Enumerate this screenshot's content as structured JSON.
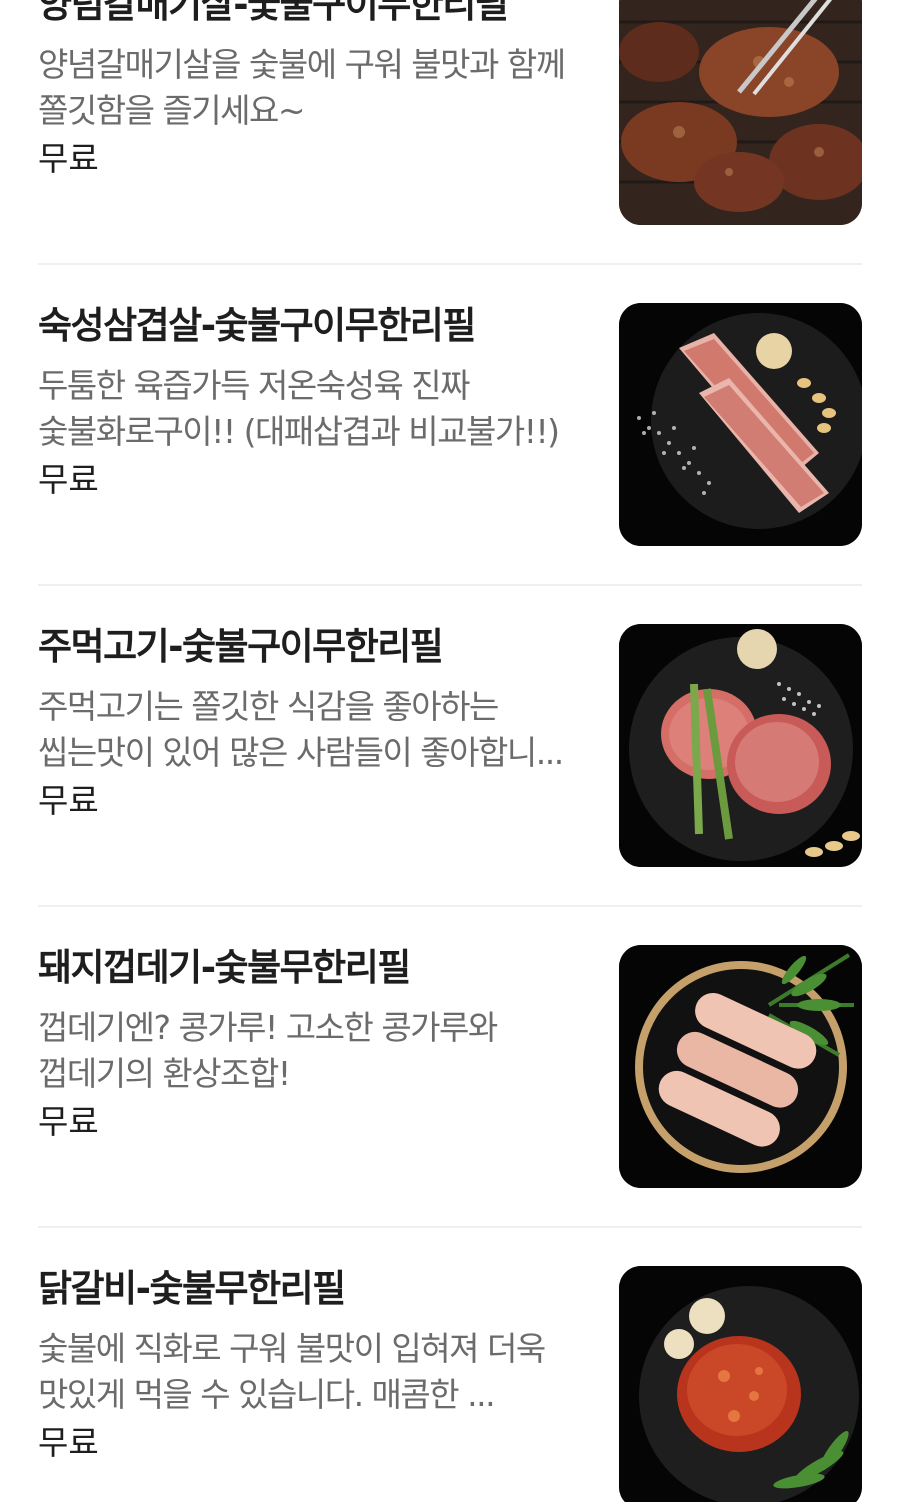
{
  "menu": {
    "items": [
      {
        "name": "양념갈매기살-숯불구이무한리필",
        "description": "양념갈매기살을 숯불에 구워 불맛과 함께 쫄깃함을 즐기세요~",
        "price": "무료",
        "image_icon": "marinated-pork-skirt-photo"
      },
      {
        "name": "숙성삼겹살-숯불구이무한리필",
        "description": "두툼한 육즙가득 저온숙성육 진짜 숯불화로구이!! (대패삽겹과 비교불가!!)",
        "price": "무료",
        "image_icon": "pork-belly-photo"
      },
      {
        "name": "주먹고기-숯불구이무한리필",
        "description": "주먹고기는 쫄깃한 식감을 좋아하는 씹는맛이 있어 많은 사람들이 좋아합니...",
        "price": "무료",
        "image_icon": "pork-neck-photo"
      },
      {
        "name": "돼지껍데기-숯불무한리필",
        "description": "껍데기엔? 콩가루! 고소한 콩가루와 껍데기의 환상조합!",
        "price": "무료",
        "image_icon": "pork-skin-photo"
      },
      {
        "name": "닭갈비-숯불무한리필",
        "description": "숯불에 직화로 구워 불맛이 입혀져 더욱 맛있게 먹을 수 있습니다. 매콤한 ...",
        "price": "무료",
        "image_icon": "spicy-chicken-photo"
      }
    ]
  }
}
